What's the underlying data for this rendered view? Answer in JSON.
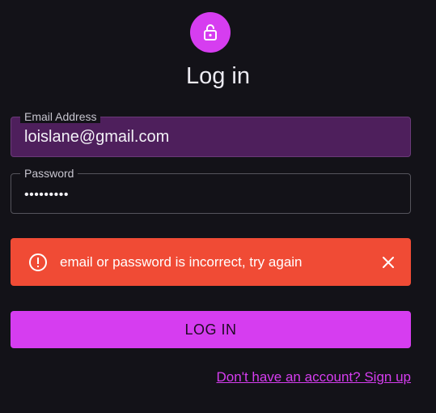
{
  "header": {
    "icon": "lock-open-icon",
    "title": "Log in"
  },
  "form": {
    "email": {
      "label": "Email Address",
      "value": "loislane@gmail.com"
    },
    "password": {
      "label": "Password",
      "value": "•••••••••"
    }
  },
  "alert": {
    "icon": "error-outline-icon",
    "message": "email or password is incorrect, try again",
    "close_icon": "close-icon"
  },
  "actions": {
    "login_label": "LOG IN",
    "signup_link": "Don't have an account? Sign up"
  },
  "colors": {
    "accent": "#d63df0",
    "error": "#f04b35",
    "background": "#131218"
  }
}
